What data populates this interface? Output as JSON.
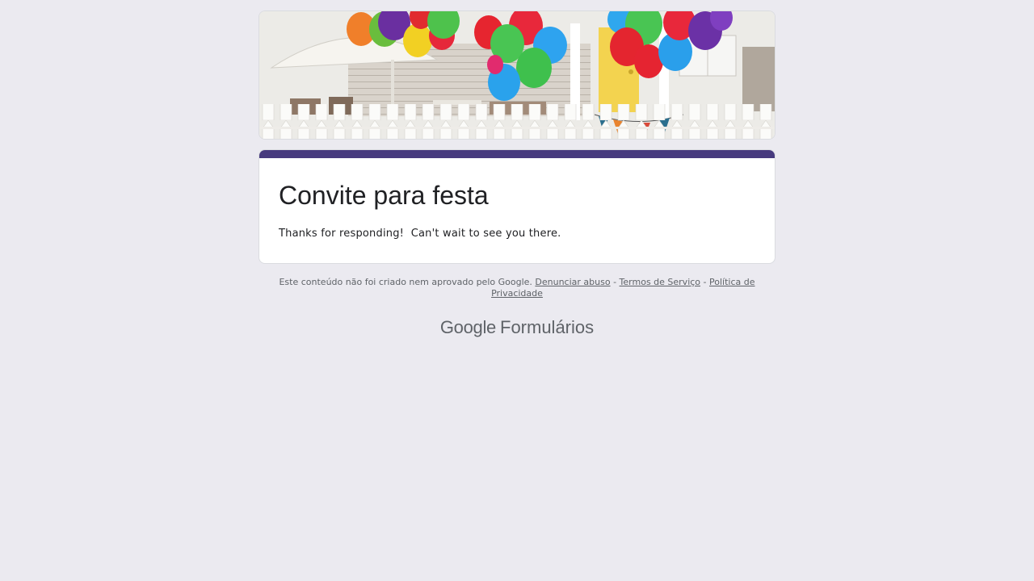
{
  "form": {
    "title": "Convite para festa",
    "confirmation_message": "Thanks for responding!  Can't wait to see you there.",
    "accent_color": "#473a7e",
    "background_color": "#ebeaf0"
  },
  "banner": {
    "image": "party-balloons-house-banner"
  },
  "footer": {
    "disclaimer": "Este conteúdo não foi criado nem aprovado pelo Google.",
    "report_abuse": "Denunciar abuso",
    "separator": " - ",
    "terms": "Termos de Serviço",
    "privacy": "Política de Privacidade"
  },
  "brand": {
    "google": "Google",
    "product": "Formulários"
  }
}
